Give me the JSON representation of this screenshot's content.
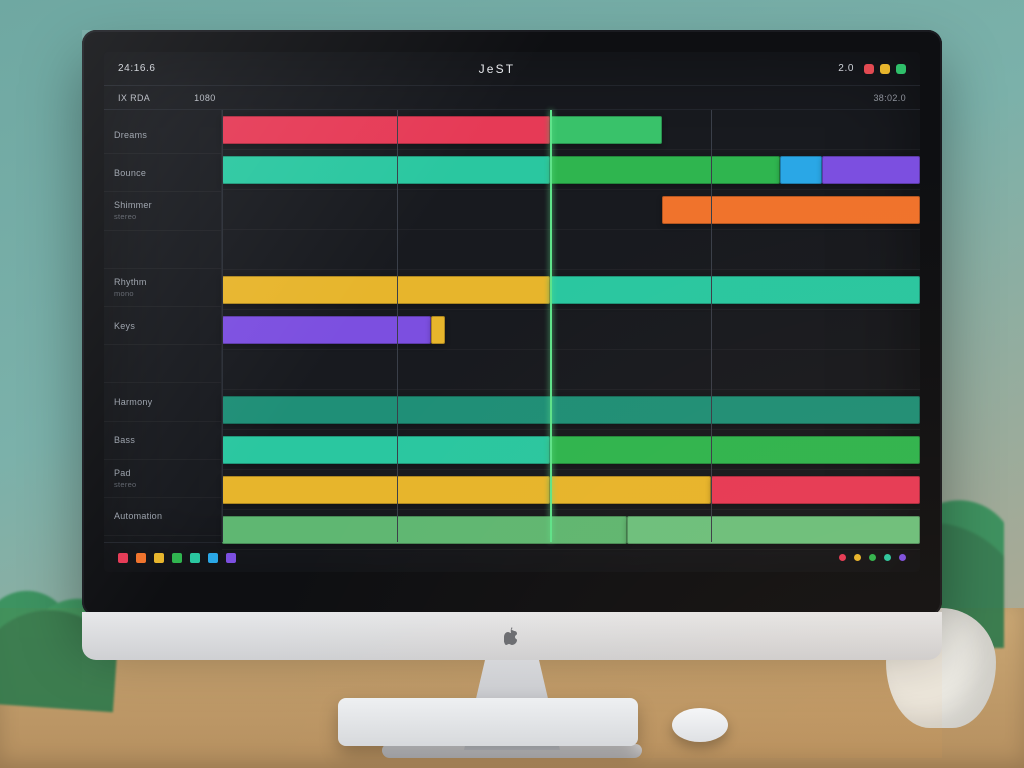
{
  "app": {
    "title": "JeST"
  },
  "topbar": {
    "left_status": "24:16.6",
    "scale_label": "2.0",
    "right_status": "38:02.0"
  },
  "infobar": {
    "tabs": [
      "IX RDA",
      "",
      "1080"
    ]
  },
  "tracks": [
    {
      "name": "Dreams",
      "sub": ""
    },
    {
      "name": "Bounce",
      "sub": ""
    },
    {
      "name": "Shimmer",
      "sub": "stereo"
    },
    {
      "name": "",
      "sub": ""
    },
    {
      "name": "Rhythm",
      "sub": "mono"
    },
    {
      "name": "Keys",
      "sub": ""
    },
    {
      "name": "",
      "sub": ""
    },
    {
      "name": "Harmony",
      "sub": ""
    },
    {
      "name": "Bass",
      "sub": ""
    },
    {
      "name": "Pad",
      "sub": "stereo"
    },
    {
      "name": "Automation",
      "sub": ""
    }
  ],
  "gridlines_pct": [
    0,
    25,
    47,
    70,
    100
  ],
  "playhead_pct": 47,
  "clips": [
    {
      "row": 0,
      "start": 0,
      "end": 47,
      "color": "#e63a56"
    },
    {
      "row": 0,
      "start": 47,
      "end": 63,
      "color": "#39c26a"
    },
    {
      "row": 1,
      "start": 0,
      "end": 47,
      "color": "#2ac7a0"
    },
    {
      "row": 1,
      "start": 47,
      "end": 80,
      "color": "#2fb54f"
    },
    {
      "row": 1,
      "start": 80,
      "end": 86,
      "color": "#2aa7e6"
    },
    {
      "row": 1,
      "start": 86,
      "end": 100,
      "color": "#7c4fe0"
    },
    {
      "row": 2,
      "start": 63,
      "end": 100,
      "color": "#f0732c"
    },
    {
      "row": 4,
      "start": 0,
      "end": 47,
      "color": "#e7b52c"
    },
    {
      "row": 4,
      "start": 47,
      "end": 100,
      "color": "#2ac7a0"
    },
    {
      "row": 5,
      "start": 0,
      "end": 30,
      "color": "#7c4fe0"
    },
    {
      "row": 5,
      "start": 30,
      "end": 32,
      "color": "#e7b52c"
    },
    {
      "row": 7,
      "start": 0,
      "end": 100,
      "color": "#1f8f77"
    },
    {
      "row": 8,
      "start": 0,
      "end": 47,
      "color": "#2ac7a0"
    },
    {
      "row": 8,
      "start": 47,
      "end": 100,
      "color": "#2fb54f"
    },
    {
      "row": 9,
      "start": 0,
      "end": 47,
      "color": "#e7b52c"
    },
    {
      "row": 9,
      "start": 47,
      "end": 70,
      "color": "#e7b52c"
    },
    {
      "row": 9,
      "start": 70,
      "end": 100,
      "color": "#e63a56"
    },
    {
      "row": 10,
      "start": 0,
      "end": 58,
      "color": "#5fb772"
    },
    {
      "row": 10,
      "start": 58,
      "end": 100,
      "color": "#6cc17e"
    }
  ],
  "bottombar": {
    "swatches": [
      "#e63a56",
      "#f0732c",
      "#e7b52c",
      "#2fb54f",
      "#2ac7a0",
      "#2aa7e6",
      "#7c4fe0"
    ],
    "status_dots": [
      "#e63a56",
      "#e7b52c",
      "#2fb54f",
      "#2ac7a0",
      "#7c4fe0"
    ]
  }
}
